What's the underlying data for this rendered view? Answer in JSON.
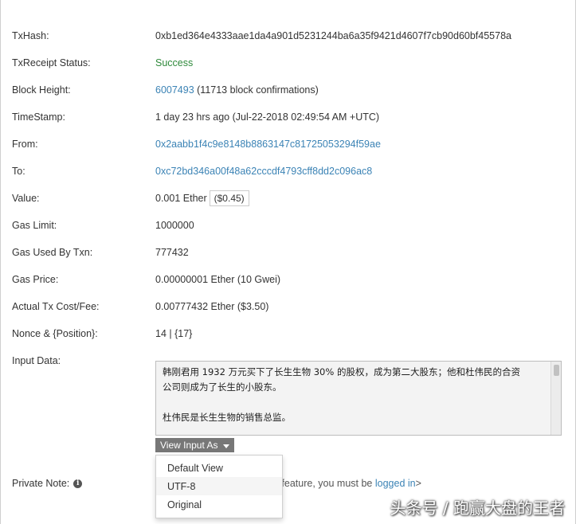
{
  "tx": {
    "rows": [
      {
        "label": "TxHash:",
        "value": "0xb1ed364e4333aae1da4a901d5231244ba6a35f9421d4607f7cb90d60bf45578a"
      },
      {
        "label": "TxReceipt Status:",
        "value": "Success"
      },
      {
        "label": "Block Height:",
        "value_link": "6007493",
        "value_rest": " (11713 block confirmations)"
      },
      {
        "label": "TimeStamp:",
        "value": "1 day 23 hrs ago (Jul-22-2018 02:49:54 AM +UTC)"
      },
      {
        "label": "From:",
        "value": "0x2aabb1f4c9e8148b8863147c81725053294f59ae"
      },
      {
        "label": "To:",
        "value": "0xc72bd346a00f48a62cccdf4793cff8dd2c096ac8"
      },
      {
        "label": "Value:",
        "value": "0.001 Ether",
        "usd": "($0.45)"
      },
      {
        "label": "Gas Limit:",
        "value": "1000000"
      },
      {
        "label": "Gas Used By Txn:",
        "value": "777432"
      },
      {
        "label": "Gas Price:",
        "value": "0.00000001 Ether (10 Gwei)"
      },
      {
        "label": "Actual Tx Cost/Fee:",
        "value": "0.00777432 Ether ($3.50)"
      },
      {
        "label": "Nonce & {Position}:",
        "value": "14 | {17}"
      },
      {
        "label": "Input Data:"
      }
    ]
  },
  "input_data": {
    "line1": "韩刚君用 1932 万元买下了长生生物 30% 的股权，成为第二大股东；他和杜伟民的合资",
    "line2": "公司则成为了长生的小股东。",
    "line3": "杜伟民是长生生物的销售总监。"
  },
  "view_input": {
    "button_label": "View Input As",
    "options": [
      "Default View",
      "UTF-8",
      "Original"
    ]
  },
  "private_note": {
    "label": "Private Note:",
    "text_before": "e feature, you must be ",
    "link": "logged in",
    "text_after": ">"
  },
  "watermark": "头条号 / 跑赢大盘的王者",
  "colors": {
    "link": "#3b83b5",
    "success": "#2f8a3b",
    "button": "#777777"
  }
}
